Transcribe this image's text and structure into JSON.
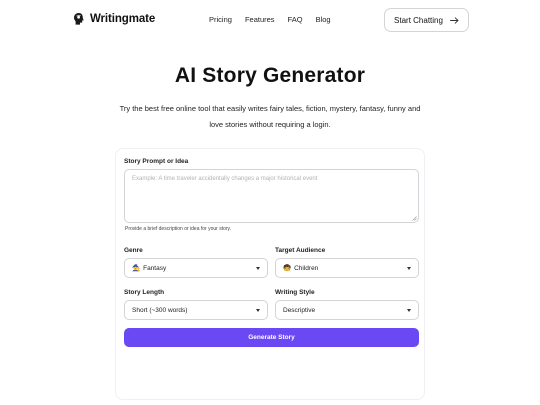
{
  "brand": {
    "name": "Writingmate"
  },
  "nav": {
    "items": [
      "Pricing",
      "Features",
      "FAQ",
      "Blog"
    ]
  },
  "cta": {
    "label": "Start Chatting"
  },
  "hero": {
    "title": "AI Story Generator",
    "subtitle": "Try the best free online tool that easily writes fairy tales, fiction, mystery, fantasy, funny and love stories without requiring a login."
  },
  "form": {
    "prompt": {
      "label": "Story Prompt or Idea",
      "placeholder": "Example: A time traveler accidentally changes a major historical event",
      "value": "",
      "hint": "Provide a brief description or idea for your story."
    },
    "genre": {
      "label": "Genre",
      "emoji": "🧙",
      "value": "Fantasy"
    },
    "audience": {
      "label": "Target Audience",
      "emoji": "🧒",
      "value": "Children"
    },
    "length": {
      "label": "Story Length",
      "value": "Short (~300 words)"
    },
    "style": {
      "label": "Writing Style",
      "value": "Descriptive"
    },
    "submit_label": "Generate Story"
  },
  "colors": {
    "accent": "#6a49f4",
    "border": "#d4d4d8",
    "text": "#111111"
  },
  "icons": {
    "brand": "brain-logo-icon",
    "cta": "arrow-right-icon",
    "select": "caret-down-icon"
  }
}
